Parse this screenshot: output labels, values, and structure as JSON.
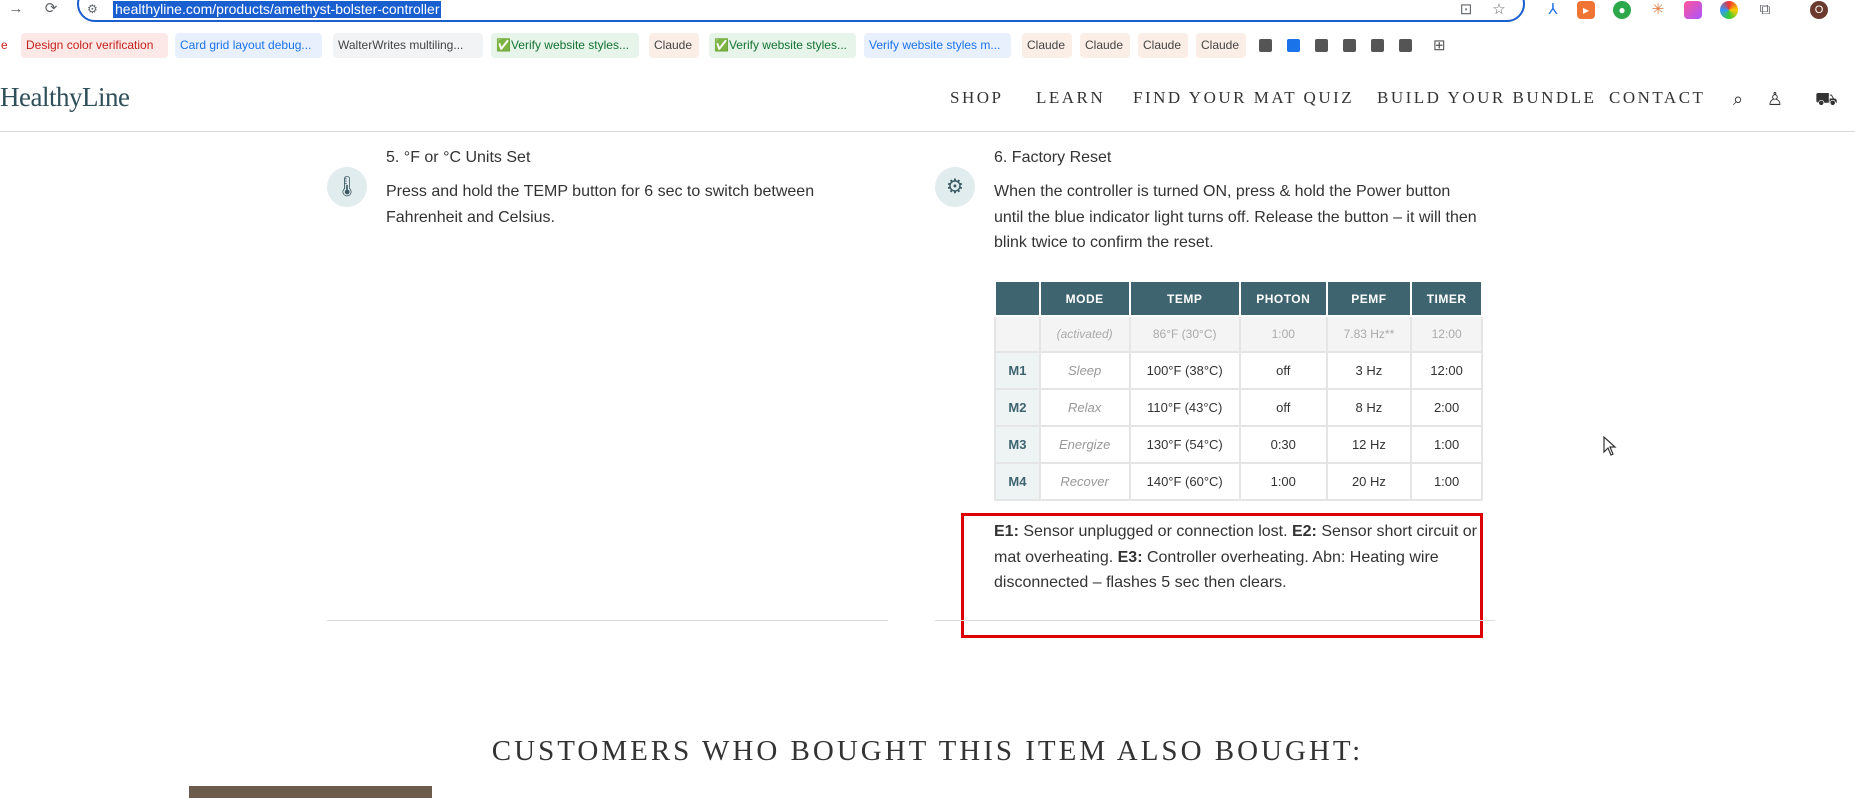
{
  "browser": {
    "url": "healthyline.com/products/amethyst-bolster-controller",
    "profile_initial": "O",
    "bookmarks": [
      {
        "label": "e",
        "color": "#c5221f",
        "bg": "#fff"
      },
      {
        "label": "Design color verification",
        "color": "#c5221f",
        "bg": "#fce8e6"
      },
      {
        "label": "Card grid layout debug...",
        "color": "#1a73e8",
        "bg": "#e8f0fe"
      },
      {
        "label": "WalterWrites multiling...",
        "color": "#444",
        "bg": "#f1f3f4"
      },
      {
        "label": "✅Verify website styles...",
        "color": "#137333",
        "bg": "#e6f4ea"
      },
      {
        "label": "Claude",
        "color": "#444",
        "bg": "#fbeee6"
      },
      {
        "label": "✅Verify website styles...",
        "color": "#137333",
        "bg": "#e6f4ea"
      },
      {
        "label": "Verify website styles m...",
        "color": "#1a73e8",
        "bg": "#e8f0fe"
      },
      {
        "label": "Claude",
        "color": "#444",
        "bg": "#fbeee6"
      },
      {
        "label": "Claude",
        "color": "#444",
        "bg": "#fbeee6"
      },
      {
        "label": "Claude",
        "color": "#444",
        "bg": "#fbeee6"
      },
      {
        "label": "Claude",
        "color": "#444",
        "bg": "#fbeee6"
      }
    ]
  },
  "site": {
    "logo": "HealthyLine",
    "nav": [
      "SHOP",
      "LEARN",
      "FIND YOUR MAT QUIZ",
      "BUILD YOUR BUNDLE",
      "CONTACT"
    ]
  },
  "steps": {
    "step5": {
      "title": "5. °F or °C Units Set",
      "body": "Press and hold the TEMP button for 6 sec to switch between Fahrenheit and Celsius."
    },
    "step6": {
      "title": "6. Factory Reset",
      "body": "When the controller is turned ON, press & hold the Power button until the blue indicator light turns off. Release the button – it will then blink twice to confirm the reset."
    }
  },
  "mode_table": {
    "headers": [
      "",
      "MODE",
      "TEMP",
      "PHOTON",
      "PEMF",
      "TIMER"
    ],
    "activated": [
      "",
      "(activated)",
      "86°F (30°C)",
      "1:00",
      "7.83 Hz**",
      "12:00"
    ],
    "rows": [
      [
        "M1",
        "Sleep",
        "100°F (38°C)",
        "off",
        "3 Hz",
        "12:00"
      ],
      [
        "M2",
        "Relax",
        "110°F (43°C)",
        "off",
        "8 Hz",
        "2:00"
      ],
      [
        "M3",
        "Energize",
        "130°F (54°C)",
        "0:30",
        "12 Hz",
        "1:00"
      ],
      [
        "M4",
        "Recover",
        "140°F (60°C)",
        "1:00",
        "20 Hz",
        "1:00"
      ]
    ]
  },
  "errors": {
    "e1_code": "E1:",
    "e1_text": " Sensor unplugged or connection lost. ",
    "e2_code": "E2:",
    "e2_text": " Sensor short circuit or mat overheating. ",
    "e3_code": "E3:",
    "e3_text": " Controller overheating. Abn: Heating wire disconnected – flashes 5 sec then clears."
  },
  "related": {
    "heading": "CUSTOMERS WHO BOUGHT THIS ITEM ALSO BOUGHT:"
  },
  "colors": {
    "accent": "#3e6470",
    "highlight": "#dd0000",
    "omnibox_focus": "#1a5fd0"
  }
}
